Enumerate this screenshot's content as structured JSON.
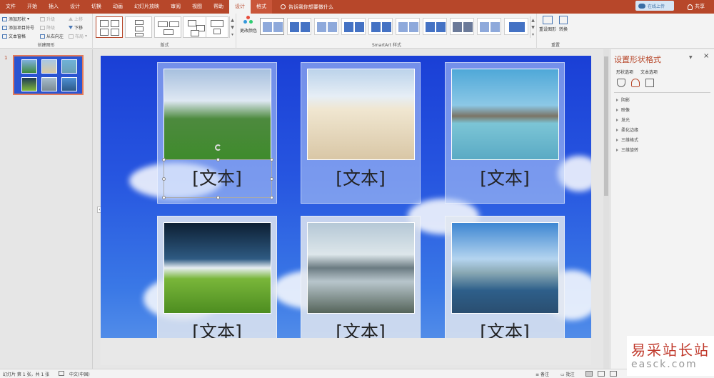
{
  "tabs": [
    "文件",
    "开始",
    "插入",
    "设计",
    "切换",
    "动画",
    "幻灯片放映",
    "审阅",
    "视图",
    "帮助",
    "设计",
    "格式"
  ],
  "active_tab_index": 10,
  "tell_me": "告诉我你想要做什么",
  "login_button": "在线上传",
  "share": "共享",
  "ribbon": {
    "create_group": {
      "label": "创建图形",
      "add_shape": "添加形状",
      "add_bullet": "添加项目符号",
      "text_pane": "文本窗格",
      "promote": "升级",
      "demote": "降级",
      "right_to_left": "从右向左",
      "move_up": "上移",
      "move_down": "下移",
      "layout": "布局"
    },
    "layouts_label": "版式",
    "change_colors": "更改颜色",
    "smartart_styles_label": "SmartArt 样式",
    "reset": {
      "label": "重置",
      "reset_graphic": "重设图形",
      "convert": "转换"
    }
  },
  "thumbnails": {
    "slide_number": "1"
  },
  "slide": {
    "cards": [
      {
        "text": "[文本]"
      },
      {
        "text": "[文本]"
      },
      {
        "text": "[文本]"
      },
      {
        "text": "[文本]"
      },
      {
        "text": "[文本]"
      },
      {
        "text": "[文本]"
      }
    ]
  },
  "format_pane": {
    "title": "设置形状格式",
    "tab_shape": "形状选项",
    "tab_text": "文本选项",
    "items": [
      "阴影",
      "映像",
      "发光",
      "柔化边缘",
      "三维格式",
      "三维旋转"
    ]
  },
  "status": {
    "slide_info": "幻灯片 第 1 张，共 1 张",
    "language": "中文(中国)",
    "notes": "备注",
    "comments": "批注"
  },
  "watermark": {
    "cn": "易采站长站",
    "en": "easck.com"
  },
  "colors": {
    "accent": "#b7472a",
    "slide_blue": "#2756e0",
    "watermark_red": "#c0392b"
  }
}
